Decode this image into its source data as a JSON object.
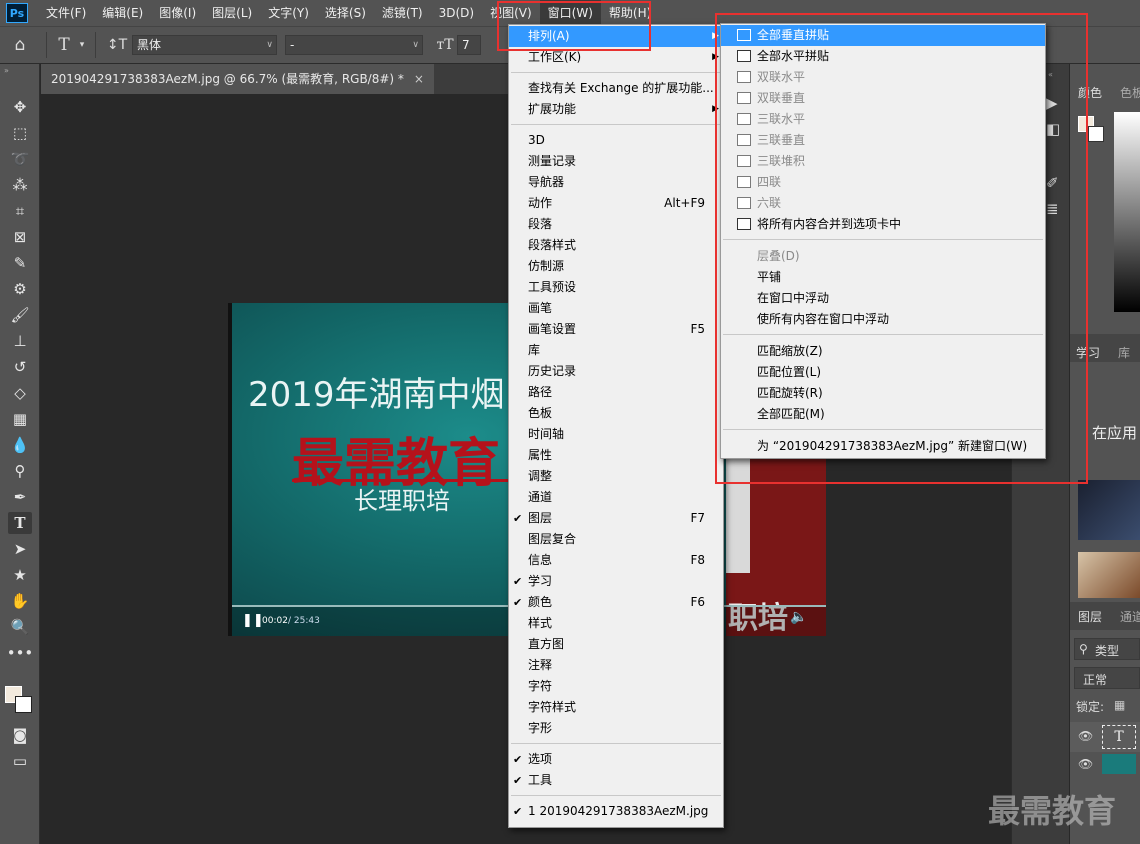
{
  "app": {
    "logo": "Ps"
  },
  "menubar": [
    "文件(F)",
    "编辑(E)",
    "图像(I)",
    "图层(L)",
    "文字(Y)",
    "选择(S)",
    "滤镜(T)",
    "3D(D)",
    "视图(V)",
    "窗口(W)",
    "帮助(H)"
  ],
  "options": {
    "font_family": "黑体",
    "font_style": "-",
    "font_size_prefix": "7"
  },
  "tools": [
    "move-icon",
    "marquee-icon",
    "lasso-icon",
    "magic-wand-icon",
    "crop-icon",
    "frame-icon",
    "eyedropper-icon",
    "healing-icon",
    "brush-icon",
    "stamp-icon",
    "history-brush-icon",
    "eraser-icon",
    "gradient-icon",
    "blur-icon",
    "dodge-icon",
    "pen-icon",
    "type-icon",
    "path-select-icon",
    "shape-icon",
    "hand-icon",
    "zoom-icon",
    "more-icon"
  ],
  "document": {
    "tab_title": "201904291738383AezM.jpg @ 66.7% (最需教育, RGB/8#) *",
    "close": "×"
  },
  "image_content": {
    "line1": "2019年湖南中烟",
    "line2": "最需教育",
    "line3": "长理职培",
    "right_fragment": "职培",
    "player_time": "00:02",
    "player_duration": "/ 25:43"
  },
  "right_panel": {
    "color_tab": "颜色",
    "swatch_tab": "色板",
    "learn_tab": "学习",
    "library_tab": "库",
    "in_app_text": "在应用",
    "layers_tab": "图层",
    "channels_tab": "通道",
    "filter_kind": "类型",
    "blend_mode": "正常",
    "lock_label": "锁定:"
  },
  "watermark": "最需教育",
  "window_menu": {
    "items": [
      {
        "label": "排列(A)",
        "submenu": true,
        "highlight": true
      },
      {
        "label": "工作区(K)",
        "submenu": true
      },
      {
        "sep": true
      },
      {
        "label": "查找有关 Exchange 的扩展功能..."
      },
      {
        "label": "扩展功能",
        "submenu": true
      },
      {
        "sep": true
      },
      {
        "label": "3D"
      },
      {
        "label": "测量记录"
      },
      {
        "label": "导航器"
      },
      {
        "label": "动作",
        "shortcut": "Alt+F9"
      },
      {
        "label": "段落"
      },
      {
        "label": "段落样式"
      },
      {
        "label": "仿制源"
      },
      {
        "label": "工具预设"
      },
      {
        "label": "画笔"
      },
      {
        "label": "画笔设置",
        "shortcut": "F5"
      },
      {
        "label": "库"
      },
      {
        "label": "历史记录"
      },
      {
        "label": "路径"
      },
      {
        "label": "色板"
      },
      {
        "label": "时间轴"
      },
      {
        "label": "属性"
      },
      {
        "label": "调整"
      },
      {
        "label": "通道"
      },
      {
        "label": "图层",
        "shortcut": "F7",
        "checked": true
      },
      {
        "label": "图层复合"
      },
      {
        "label": "信息",
        "shortcut": "F8"
      },
      {
        "label": "学习",
        "checked": true
      },
      {
        "label": "颜色",
        "shortcut": "F6",
        "checked": true
      },
      {
        "label": "样式"
      },
      {
        "label": "直方图"
      },
      {
        "label": "注释"
      },
      {
        "label": "字符"
      },
      {
        "label": "字符样式"
      },
      {
        "label": "字形"
      },
      {
        "sep": true
      },
      {
        "label": "选项",
        "checked": true
      },
      {
        "label": "工具",
        "checked": true
      },
      {
        "sep": true
      },
      {
        "label": "1 201904291738383AezM.jpg",
        "checked": true
      }
    ]
  },
  "arrange_menu": {
    "items": [
      {
        "label": "全部垂直拼贴",
        "icon": "tile-vertical-icon",
        "highlight": true
      },
      {
        "label": "全部水平拼贴",
        "icon": "tile-horizontal-icon"
      },
      {
        "label": "双联水平",
        "icon": "two-up-horizontal-icon",
        "disabled": true
      },
      {
        "label": "双联垂直",
        "icon": "two-up-vertical-icon",
        "disabled": true
      },
      {
        "label": "三联水平",
        "icon": "three-up-horizontal-icon",
        "disabled": true
      },
      {
        "label": "三联垂直",
        "icon": "three-up-vertical-icon",
        "disabled": true
      },
      {
        "label": "三联堆积",
        "icon": "three-up-stacked-icon",
        "disabled": true
      },
      {
        "label": "四联",
        "icon": "four-up-icon",
        "disabled": true
      },
      {
        "label": "六联",
        "icon": "six-up-icon",
        "disabled": true
      },
      {
        "label": "将所有内容合并到选项卡中",
        "icon": "consolidate-tabs-icon"
      },
      {
        "sep": true
      },
      {
        "label": "层叠(D)",
        "disabled": true
      },
      {
        "label": "平铺"
      },
      {
        "label": "在窗口中浮动"
      },
      {
        "label": "使所有内容在窗口中浮动"
      },
      {
        "sep": true
      },
      {
        "label": "匹配缩放(Z)"
      },
      {
        "label": "匹配位置(L)"
      },
      {
        "label": "匹配旋转(R)"
      },
      {
        "label": "全部匹配(M)"
      },
      {
        "sep": true
      },
      {
        "label": "为 “201904291738383AezM.jpg” 新建窗口(W)"
      }
    ]
  },
  "colors": {
    "menu_highlight": "#3399ff",
    "annotation_red": "#e8312f",
    "image_red": "#b5121b"
  }
}
